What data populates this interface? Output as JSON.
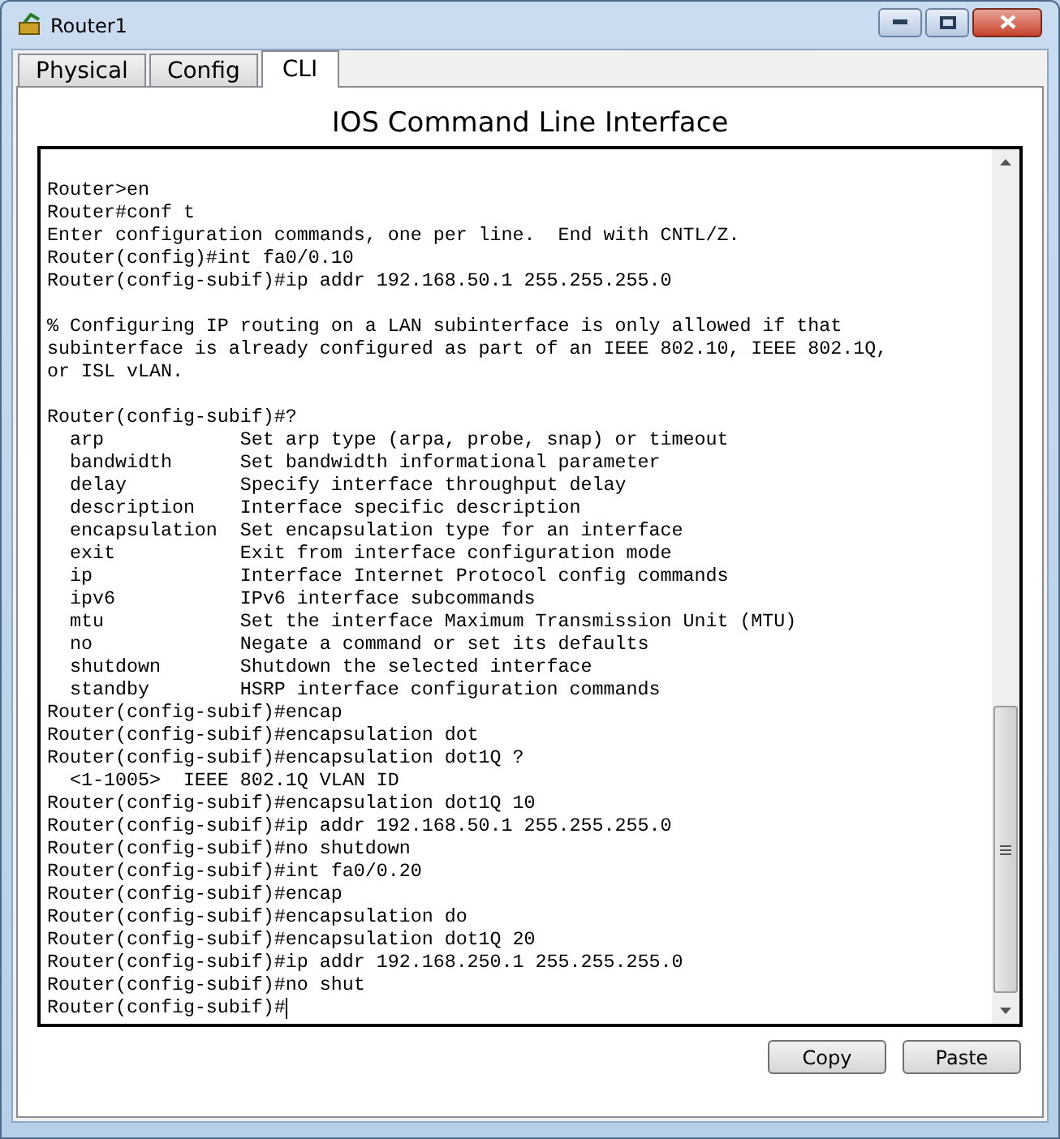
{
  "window": {
    "title": "Router1"
  },
  "tabs": [
    {
      "label": "Physical",
      "selected": false
    },
    {
      "label": "Config",
      "selected": false
    },
    {
      "label": "CLI",
      "selected": true
    }
  ],
  "heading": "IOS Command Line Interface",
  "terminal": {
    "blocks": [
      [
        "Router>en",
        "Router#conf t",
        "Enter configuration commands, one per line.  End with CNTL/Z.",
        "Router(config)#int fa0/0.10",
        "Router(config-subif)#ip addr 192.168.50.1 255.255.255.0"
      ],
      [
        "% Configuring IP routing on a LAN subinterface is only allowed if that",
        "subinterface is already configured as part of an IEEE 802.10, IEEE 802.1Q,",
        "or ISL vLAN."
      ],
      [
        "Router(config-subif)#?",
        "  arp            Set arp type (arpa, probe, snap) or timeout",
        "  bandwidth      Set bandwidth informational parameter",
        "  delay          Specify interface throughput delay",
        "  description    Interface specific description",
        "  encapsulation  Set encapsulation type for an interface",
        "  exit           Exit from interface configuration mode",
        "  ip             Interface Internet Protocol config commands",
        "  ipv6           IPv6 interface subcommands",
        "  mtu            Set the interface Maximum Transmission Unit (MTU)",
        "  no             Negate a command or set its defaults",
        "  shutdown       Shutdown the selected interface",
        "  standby        HSRP interface configuration commands",
        "Router(config-subif)#encap",
        "Router(config-subif)#encapsulation dot",
        "Router(config-subif)#encapsulation dot1Q ?",
        "  <1-1005>  IEEE 802.1Q VLAN ID",
        "Router(config-subif)#encapsulation dot1Q 10",
        "Router(config-subif)#ip addr 192.168.50.1 255.255.255.0",
        "Router(config-subif)#no shutdown",
        "Router(config-subif)#int fa0/0.20",
        "Router(config-subif)#encap",
        "Router(config-subif)#encapsulation do",
        "Router(config-subif)#encapsulation dot1Q 20",
        "Router(config-subif)#ip addr 192.168.250.1 255.255.255.0",
        "Router(config-subif)#no shut",
        "Router(config-subif)#"
      ]
    ]
  },
  "buttons": [
    "Copy",
    "Paste"
  ]
}
